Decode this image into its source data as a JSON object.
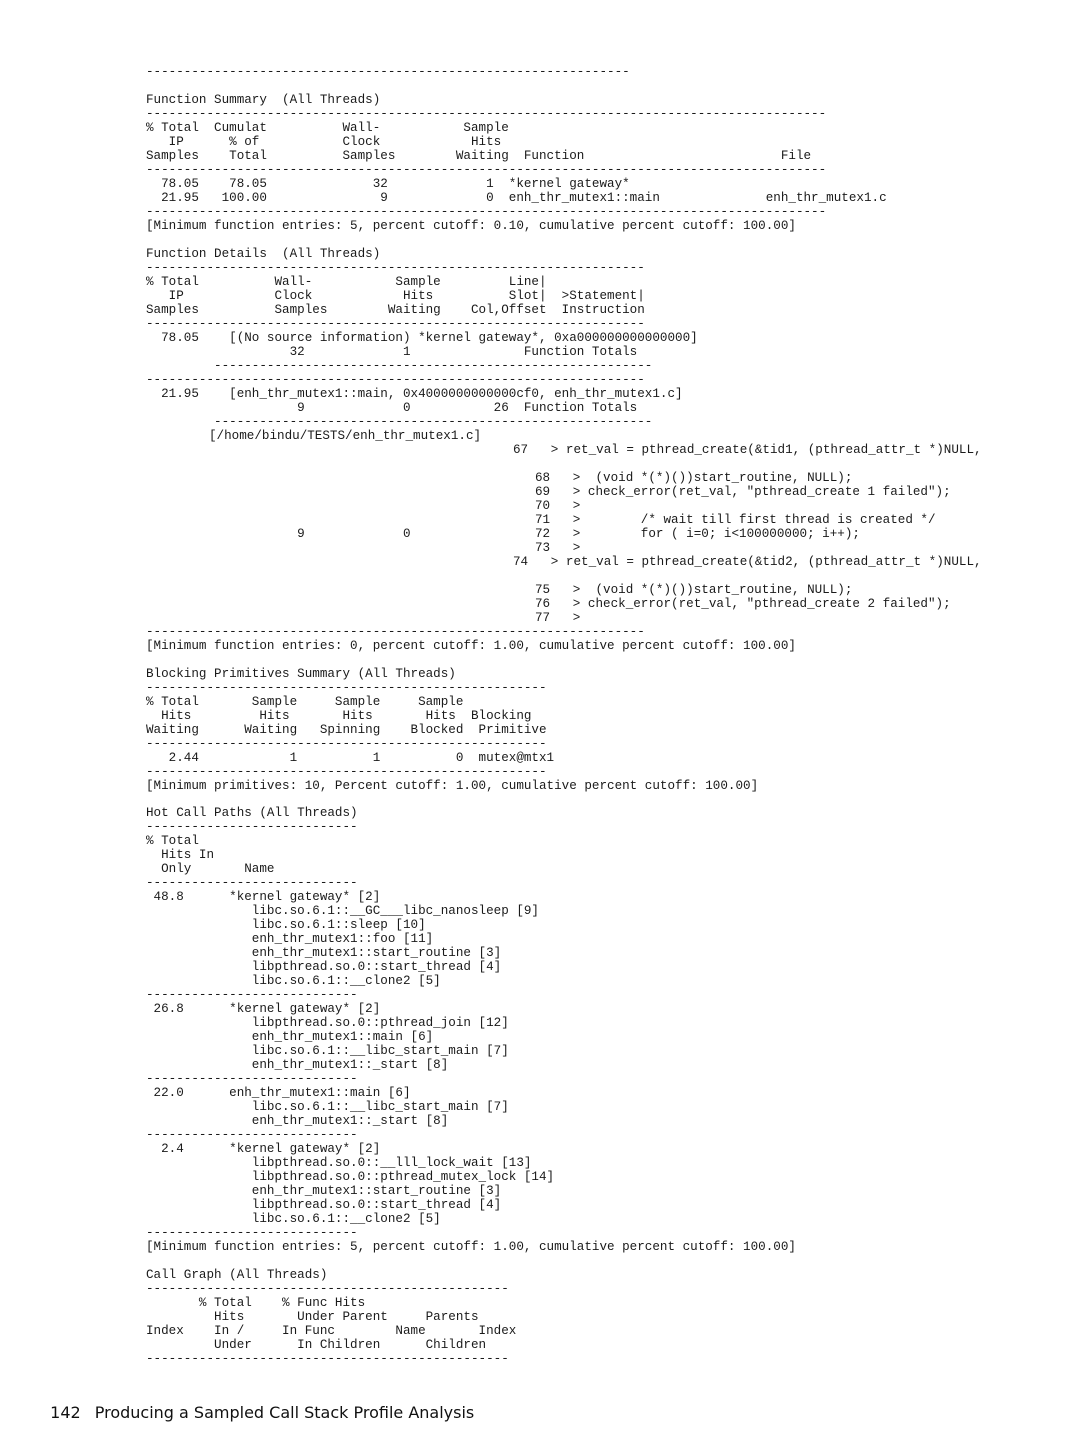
{
  "function_summary": {
    "top_rule": "----------------------------------------------------------------",
    "title": "Function Summary  (All Threads)",
    "rule": "------------------------------------------------------------------------------------------",
    "header": [
      "% Total  Cumulat          Wall-           Sample",
      "   IP      % of           Clock            Hits",
      "Samples    Total          Samples        Waiting  Function                          File"
    ],
    "rows": [
      "  78.05    78.05              32             1  *kernel gateway*",
      "  21.95   100.00               9             0  enh_thr_mutex1::main              enh_thr_mutex1.c"
    ],
    "footnote": "[Minimum function entries: 5, percent cutoff: 0.10, cumulative percent cutoff: 100.00]"
  },
  "function_details": {
    "title": "Function Details  (All Threads)",
    "rule": "------------------------------------------------------------------",
    "header": [
      "% Total          Wall-           Sample         Line|",
      "   IP            Clock            Hits          Slot|  >Statement|",
      "Samples          Samples        Waiting    Col,Offset  Instruction"
    ],
    "entries": [
      {
        "line1": "  78.05    [(No source information) *kernel gateway*, 0xa000000000000000]",
        "line2": "                   32             1               Function Totals",
        "subrule": "         ----------------------------------------------------------"
      },
      {
        "line1": "  21.95    [enh_thr_mutex1::main, 0x4000000000000cf0, enh_thr_mutex1.c]",
        "line2": "                    9             0           26  Function Totals",
        "subrule": "         ----------------------------------------------------------"
      }
    ],
    "source_path": "[/home/bindu/TESTS/enh_thr_mutex1.c]",
    "source_lines": [
      "67   > ret_val = pthread_create(&tid1, (pthread_attr_t *)NULL,",
      "68   >  (void *(*)())start_routine, NULL);",
      "69   > check_error(ret_val, \"pthread_create 1 failed\");",
      "70   >",
      "71   >        /* wait till first thread is created */",
      "72   >        for ( i=0; i<100000000; i++);",
      "73   >",
      "74   > ret_val = pthread_create(&tid2, (pthread_attr_t *)NULL,",
      "75   >  (void *(*)())start_routine, NULL);",
      "76   > check_error(ret_val, \"pthread_create 2 failed\");",
      "77   >"
    ],
    "line72_values": "                    9             0",
    "footnote": "[Minimum function entries: 0, percent cutoff: 1.00, cumulative percent cutoff: 100.00]"
  },
  "blocking_primitives": {
    "title": "Blocking Primitives Summary (All Threads)",
    "rule": "-----------------------------------------------------",
    "header": [
      "% Total       Sample     Sample     Sample",
      "  Hits         Hits       Hits       Hits  Blocking",
      "Waiting      Waiting   Spinning    Blocked  Primitive"
    ],
    "rows": [
      "   2.44            1          1          0  mutex@mtx1"
    ],
    "footnote": "[Minimum primitives: 10, Percent cutoff: 1.00, cumulative percent cutoff: 100.00]"
  },
  "hot_call_paths": {
    "title": "Hot Call Paths (All Threads)",
    "rule": "----------------------------",
    "header": [
      "% Total",
      "  Hits In",
      "  Only       Name"
    ],
    "paths": [
      {
        "lines": [
          " 48.8      *kernel gateway* [2]",
          "              libc.so.6.1::__GC___libc_nanosleep [9]",
          "              libc.so.6.1::sleep [10]",
          "              enh_thr_mutex1::foo [11]",
          "              enh_thr_mutex1::start_routine [3]",
          "              libpthread.so.0::start_thread [4]",
          "              libc.so.6.1::__clone2 [5]"
        ]
      },
      {
        "lines": [
          " 26.8      *kernel gateway* [2]",
          "              libpthread.so.0::pthread_join [12]",
          "              enh_thr_mutex1::main [6]",
          "              libc.so.6.1::__libc_start_main [7]",
          "              enh_thr_mutex1::_start [8]"
        ]
      },
      {
        "lines": [
          " 22.0      enh_thr_mutex1::main [6]",
          "              libc.so.6.1::__libc_start_main [7]",
          "              enh_thr_mutex1::_start [8]"
        ]
      },
      {
        "lines": [
          "  2.4      *kernel gateway* [2]",
          "              libpthread.so.0::__lll_lock_wait [13]",
          "              libpthread.so.0::pthread_mutex_lock [14]",
          "              enh_thr_mutex1::start_routine [3]",
          "              libpthread.so.0::start_thread [4]",
          "              libc.so.6.1::__clone2 [5]"
        ]
      }
    ],
    "footnote": "[Minimum function entries: 5, percent cutoff: 1.00, cumulative percent cutoff: 100.00]"
  },
  "call_graph": {
    "title": "Call Graph (All Threads)",
    "rule": "------------------------------------------------",
    "header": [
      "       % Total    % Func Hits",
      "         Hits       Under Parent     Parents",
      "Index    In /     In Func        Name       Index",
      "         Under      In Children      Children"
    ]
  },
  "footer": {
    "page_number": "142",
    "chapter_title": "Producing a Sampled Call Stack Profile Analysis"
  }
}
